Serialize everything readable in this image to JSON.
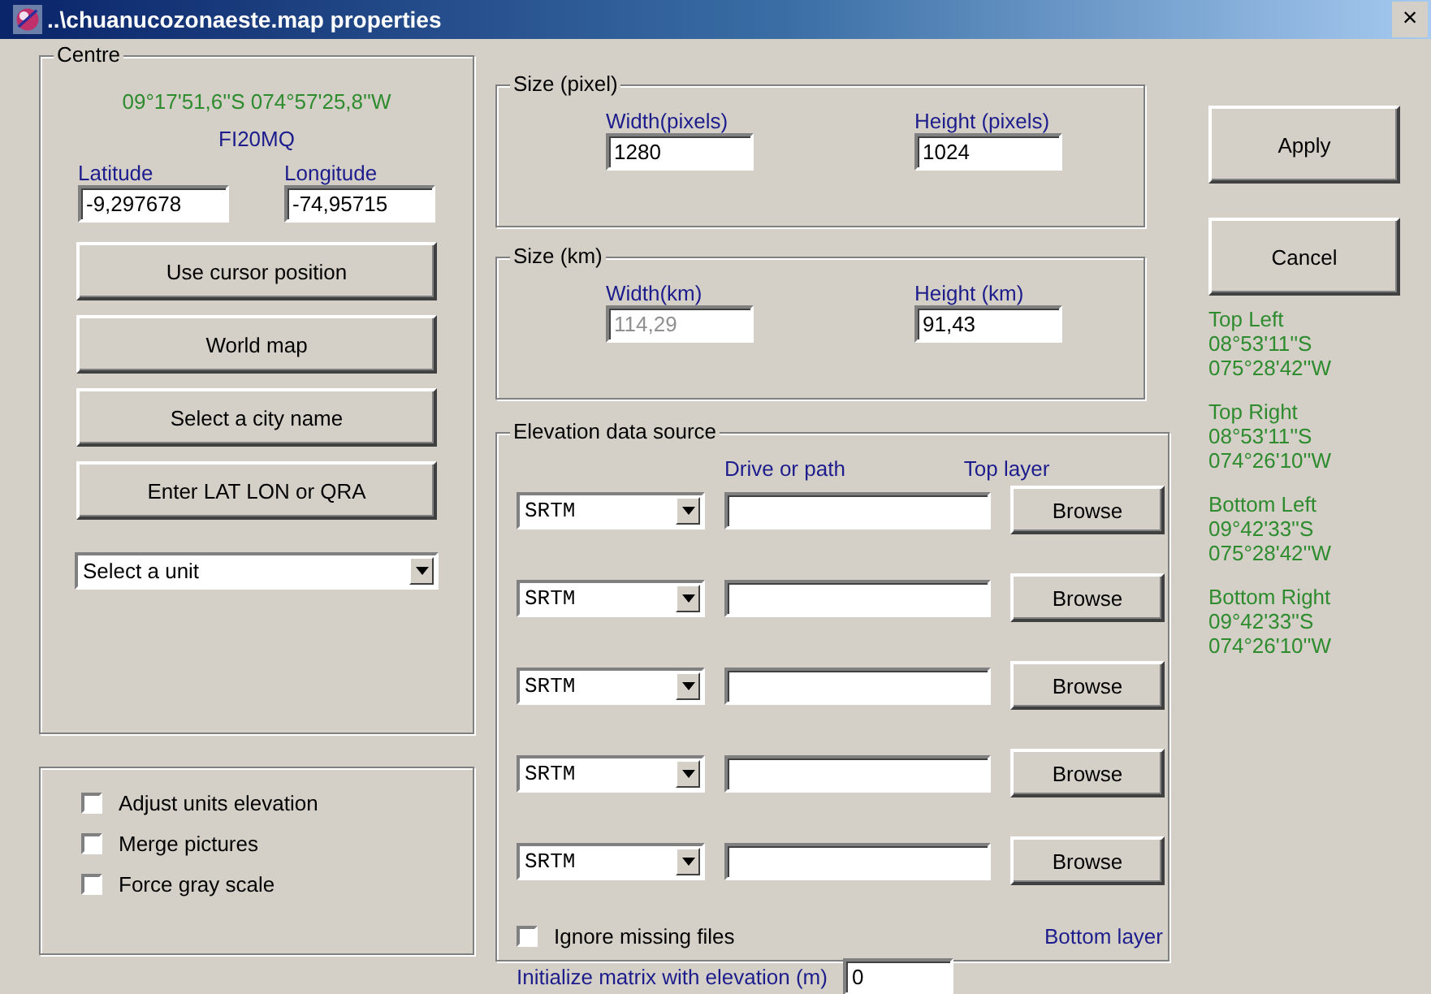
{
  "window": {
    "title": "..\\chuanucozonaeste.map properties",
    "close": "×"
  },
  "centre": {
    "title": "Centre",
    "coordinates": "09°17'51,6''S 074°57'25,8''W",
    "locator": "FI20MQ",
    "latitude": {
      "label": "Latitude",
      "value": "-9,297678"
    },
    "longitude": {
      "label": "Longitude",
      "value": "-74,95715"
    },
    "buttons": [
      "Use cursor position",
      "World map",
      "Select a city name",
      "Enter LAT LON or QRA"
    ],
    "unit_select": {
      "value": "Select a unit"
    }
  },
  "options": [
    {
      "label": "Adjust units elevation",
      "checked": false
    },
    {
      "label": "Merge pictures",
      "checked": false
    },
    {
      "label": "Force gray scale",
      "checked": false
    }
  ],
  "size_pixel": {
    "title": "Size (pixel)",
    "width": {
      "label": "Width(pixels)",
      "value": "1280",
      "disabled": false
    },
    "height": {
      "label": "Height (pixels)",
      "value": "1024",
      "disabled": false
    }
  },
  "size_km": {
    "title": "Size (km)",
    "width": {
      "label": "Width(km)",
      "value": "114,29",
      "disabled": true
    },
    "height": {
      "label": "Height (km)",
      "value": "91,43",
      "disabled": false
    }
  },
  "elevation": {
    "title": "Elevation data source",
    "path_header": "Drive or path",
    "top_label": "Top layer",
    "bottom_label": "Bottom layer",
    "sources": [
      {
        "type": "SRTM",
        "button": "Browse"
      },
      {
        "type": "SRTM",
        "button": "Browse"
      },
      {
        "type": "SRTM",
        "button": "Browse"
      },
      {
        "type": "SRTM",
        "button": "Browse"
      },
      {
        "type": "SRTM",
        "button": "Browse"
      }
    ],
    "ignore_missing": {
      "label": "Ignore missing files",
      "checked": false
    },
    "init": {
      "label": "Initialize matrix with elevation (m)",
      "value": "0"
    }
  },
  "actions": [
    "Apply",
    "Cancel"
  ],
  "corners": [
    {
      "label": "Top Left",
      "lat": "08°53'11''S",
      "lon": "075°28'42''W"
    },
    {
      "label": "Top Right",
      "lat": "08°53'11''S",
      "lon": "074°26'10''W"
    },
    {
      "label": "Bottom Left",
      "lat": "09°42'33''S",
      "lon": "075°28'42''W"
    },
    {
      "label": "Bottom Right",
      "lat": "09°42'33''S",
      "lon": "074°26'10''W"
    }
  ]
}
